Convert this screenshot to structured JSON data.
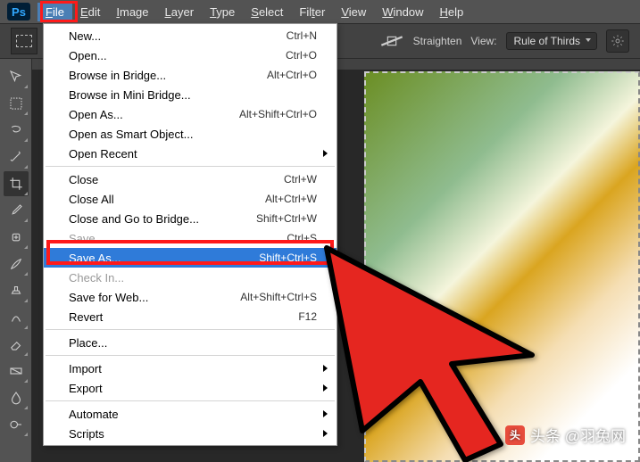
{
  "app": {
    "logo": "Ps"
  },
  "menubar": [
    {
      "label": "File",
      "hotkey": "F",
      "active": true
    },
    {
      "label": "Edit",
      "hotkey": "E"
    },
    {
      "label": "Image",
      "hotkey": "I"
    },
    {
      "label": "Layer",
      "hotkey": "L"
    },
    {
      "label": "Type",
      "hotkey": "T"
    },
    {
      "label": "Select",
      "hotkey": "S"
    },
    {
      "label": "Filter",
      "hotkey": "t"
    },
    {
      "label": "View",
      "hotkey": "V"
    },
    {
      "label": "Window",
      "hotkey": "W"
    },
    {
      "label": "Help",
      "hotkey": "H"
    }
  ],
  "options_bar": {
    "straighten": "Straighten",
    "view_label": "View:",
    "view_value": "Rule of Thirds"
  },
  "file_menu": {
    "items": [
      {
        "label": "New...",
        "shortcut": "Ctrl+N"
      },
      {
        "label": "Open...",
        "shortcut": "Ctrl+O"
      },
      {
        "label": "Browse in Bridge...",
        "shortcut": "Alt+Ctrl+O"
      },
      {
        "label": "Browse in Mini Bridge..."
      },
      {
        "label": "Open As...",
        "shortcut": "Alt+Shift+Ctrl+O"
      },
      {
        "label": "Open as Smart Object..."
      },
      {
        "label": "Open Recent",
        "submenu": true
      },
      {
        "sep": true
      },
      {
        "label": "Close",
        "shortcut": "Ctrl+W"
      },
      {
        "label": "Close All",
        "shortcut": "Alt+Ctrl+W"
      },
      {
        "label": "Close and Go to Bridge...",
        "shortcut": "Shift+Ctrl+W"
      },
      {
        "label": "Save",
        "shortcut": "Ctrl+S",
        "disabled": true
      },
      {
        "label": "Save As...",
        "shortcut": "Shift+Ctrl+S",
        "highlight": true
      },
      {
        "label": "Check In...",
        "disabled": true
      },
      {
        "label": "Save for Web...",
        "shortcut": "Alt+Shift+Ctrl+S"
      },
      {
        "label": "Revert",
        "shortcut": "F12"
      },
      {
        "sep": true
      },
      {
        "label": "Place..."
      },
      {
        "sep": true
      },
      {
        "label": "Import",
        "submenu": true
      },
      {
        "label": "Export",
        "submenu": true
      },
      {
        "sep": true
      },
      {
        "label": "Automate",
        "submenu": true
      },
      {
        "label": "Scripts",
        "submenu": true
      }
    ]
  },
  "watermark": {
    "text": "头条 @羽兔网"
  }
}
